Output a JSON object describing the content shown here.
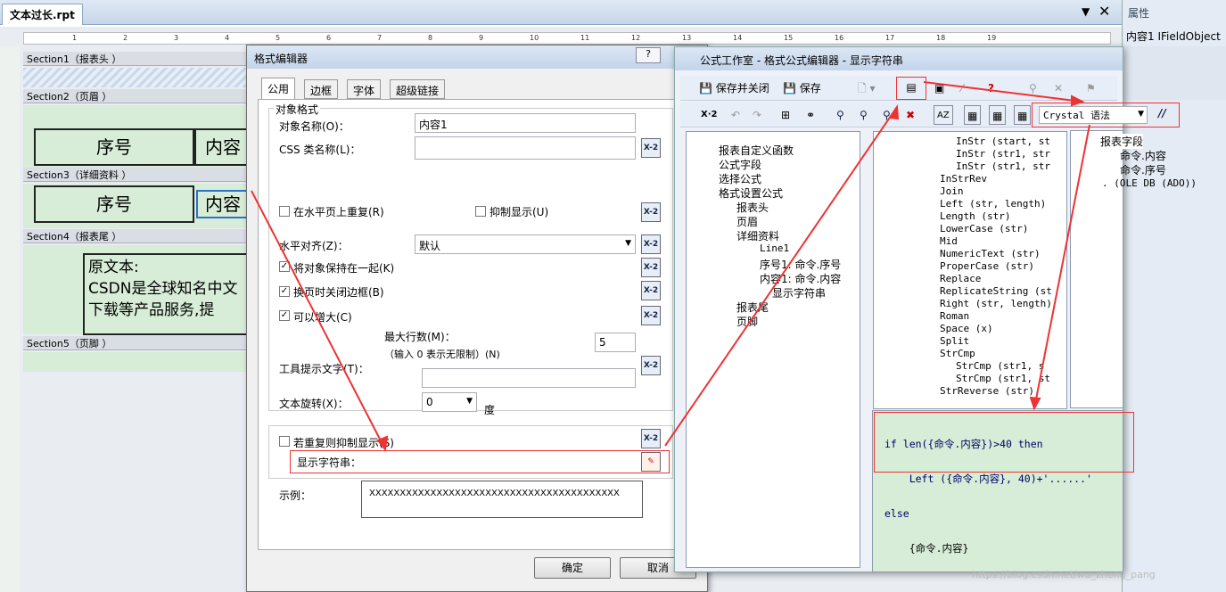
{
  "document": {
    "tab_title": "文本过长.rpt",
    "ruler_numbers": [
      "1",
      "2",
      "3",
      "4",
      "5",
      "6",
      "7",
      "8",
      "9",
      "10",
      "11",
      "12",
      "13",
      "14",
      "15",
      "16",
      "17",
      "18",
      "19"
    ]
  },
  "sections": [
    {
      "head": "Section1（报表头 ）"
    },
    {
      "head": "Section2（页眉 ）",
      "field1": "序号",
      "field2": "内容"
    },
    {
      "head": "Section3（详细资料 ）",
      "field1": "序号",
      "field2": "内容"
    },
    {
      "head": "Section4（报表尾 ）",
      "text_line1": "原文本:",
      "text_line2": "CSDN是全球知名中文",
      "text_line3": "下载等产品服务,提"
    },
    {
      "head": "Section5（页脚 ）"
    }
  ],
  "properties_panel": {
    "title": "属性",
    "object": "内容1 IFieldObject"
  },
  "format_editor": {
    "title": "格式编辑器",
    "help": "?",
    "tabs": [
      "公用",
      "边框",
      "字体",
      "超级链接"
    ],
    "group_label": "对象格式",
    "object_name_label": "对象名称(O)：",
    "object_name_value": "内容1",
    "css_label": "CSS 类名称(L)：",
    "repeat_label": "在水平页上重复(R)",
    "suppress_label": "抑制显示(U)",
    "halign_label": "水平对齐(Z)：",
    "halign_value": "默认",
    "keep_together_label": "将对象保持在一起(K)",
    "close_border_label": "换页时关闭边框(B)",
    "can_grow_label": "可以增大(C)",
    "max_lines_label": "最大行数(M)：",
    "max_lines_hint": "（输入 0 表示无限制）(N)",
    "max_lines_value": "5",
    "tooltip_label": "工具提示文字(T)：",
    "rotation_label": "文本旋转(X)：",
    "rotation_value": "0",
    "degree_label": "度",
    "suppress_dup_label": "若重复则抑制显示(S)",
    "display_string_label": "显示字符串：",
    "sample_label": "示例：",
    "sample_value": "XXXXXXXXXXXXXXXXXXXXXXXXXXXXXXXXXXXXXXXXX",
    "ok": "确定",
    "cancel": "取消",
    "xbtn": "X-2"
  },
  "formula_workshop": {
    "title": "公式工作室 - 格式公式编辑器 - 显示字符串",
    "save_close": "保存并关闭",
    "save": "保存",
    "syntax": "Crystal 语法",
    "comment": "//",
    "tree": [
      "报表自定义函数",
      "公式字段",
      "选择公式",
      "格式设置公式",
      "报表头",
      "页眉",
      "详细资料",
      "Line1",
      "序号1: 命令.序号",
      "内容1: 命令.内容",
      "显示字符串",
      "报表尾",
      "页脚"
    ],
    "functions": [
      "InStr (start, st",
      "InStr (str1, str",
      "InStr (str1, str",
      "InStrRev",
      "Join",
      "Left (str, length)",
      "Length (str)",
      "LowerCase (str)",
      "Mid",
      "NumericText (str)",
      "ProperCase (str)",
      "Replace",
      "ReplicateString (st",
      "Right (str, length)",
      "Roman",
      "Space (x)",
      "Split",
      "StrCmp",
      "StrCmp (str1, s",
      "StrCmp (str1, st",
      "StrReverse (str)"
    ],
    "fields": [
      "报表字段",
      "命令.内容",
      "命令.序号",
      ". (OLE DB (ADO))"
    ],
    "code": [
      "if len({命令.内容})>40 then",
      "    Left ({命令.内容}, 40)+'......'",
      "else",
      "    {命令.内容}"
    ]
  },
  "watermark": "https://blog.csdn.net/wu_zheng_pang"
}
